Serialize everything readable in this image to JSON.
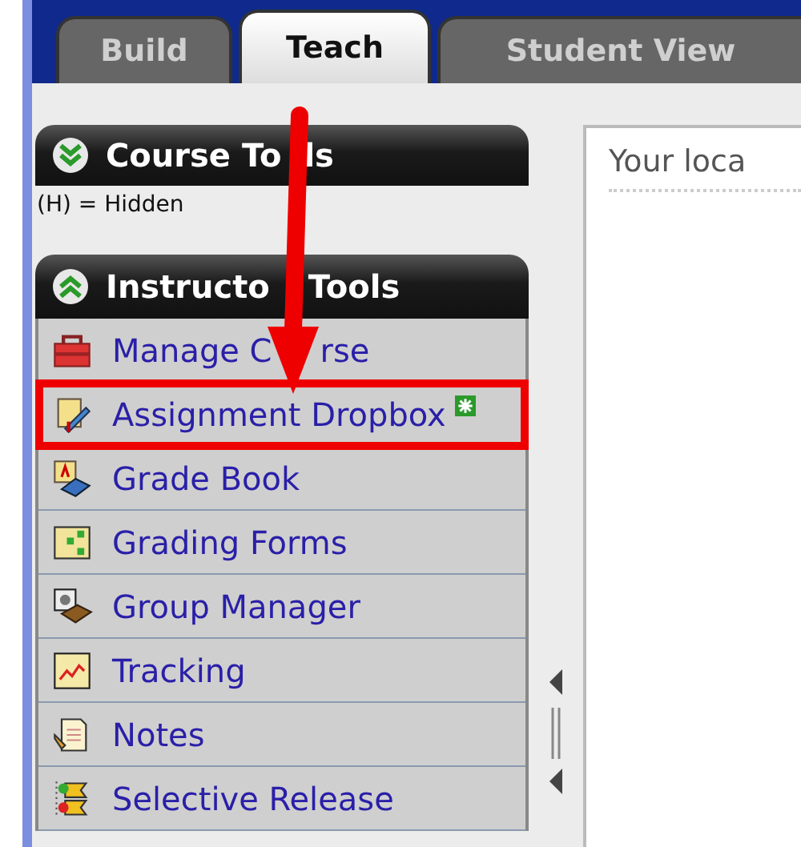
{
  "tabs": [
    {
      "label": "Build",
      "selected": false
    },
    {
      "label": "Teach",
      "selected": true
    },
    {
      "label": "Student View",
      "selected": false
    }
  ],
  "course_tools": {
    "title": [
      "Course To",
      "ls"
    ],
    "expanded": false,
    "note": "(H) = Hidden"
  },
  "instructor_tools": {
    "title": [
      "Instructo",
      "Tools"
    ],
    "expanded": true,
    "items": [
      {
        "label": [
          "Manage C",
          "rse"
        ],
        "highlighted": false,
        "new": false
      },
      {
        "label": "Assignment Dropbox",
        "highlighted": true,
        "new": true
      },
      {
        "label": "Grade Book",
        "highlighted": false,
        "new": false
      },
      {
        "label": "Grading Forms",
        "highlighted": false,
        "new": false
      },
      {
        "label": "Group Manager",
        "highlighted": false,
        "new": false
      },
      {
        "label": "Tracking",
        "highlighted": false,
        "new": false
      },
      {
        "label": "Notes",
        "highlighted": false,
        "new": false
      },
      {
        "label": "Selective Release",
        "highlighted": false,
        "new": false
      }
    ]
  },
  "content": {
    "location": "Your loca"
  }
}
